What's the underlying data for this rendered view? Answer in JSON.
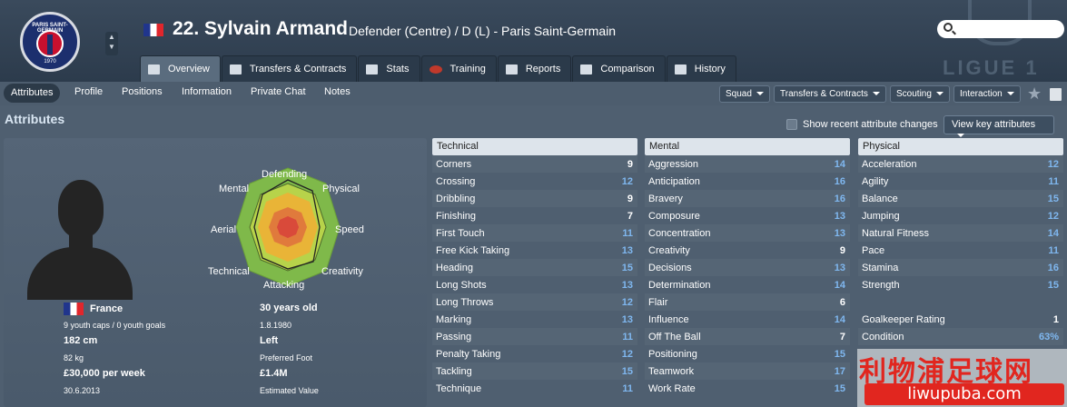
{
  "header": {
    "player_name": "22. Sylvain Armand",
    "role": "Defender (Centre) / D (L) - Paris Saint-Germain",
    "club_logo_text": "PARIS SAINT-GERMAIN",
    "club_logo_year": "1970",
    "league_logo_text": "LIGUE 1"
  },
  "tabs": [
    {
      "label": "Overview",
      "icon": "overview-icon",
      "active": true
    },
    {
      "label": "Transfers & Contracts",
      "icon": "contracts-icon"
    },
    {
      "label": "Stats",
      "icon": "stats-icon"
    },
    {
      "label": "Training",
      "icon": "training-icon"
    },
    {
      "label": "Reports",
      "icon": "reports-icon"
    },
    {
      "label": "Comparison",
      "icon": "comparison-icon"
    },
    {
      "label": "History",
      "icon": "history-icon"
    }
  ],
  "subnav": [
    "Attributes",
    "Profile",
    "Positions",
    "Information",
    "Private Chat",
    "Notes"
  ],
  "dropdowns": [
    "Squad",
    "Transfers & Contracts",
    "Scouting",
    "Interaction"
  ],
  "section_title": "Attributes",
  "show_recent_label": "Show recent attribute changes",
  "view_key_label": "View key attributes",
  "spider_labels": [
    "Defending",
    "Physical",
    "Speed",
    "Creativity",
    "Attacking",
    "Technical",
    "Aerial",
    "Mental"
  ],
  "profile": {
    "nation": "France",
    "caps": "9 youth caps / 0 youth goals",
    "age": "30 years old",
    "dob": "1.8.1980",
    "height": "182 cm",
    "weight": "82 kg",
    "foot": "Left",
    "foot_label": "Preferred Foot",
    "wage": "£30,000 per week",
    "contract_end": "30.6.2013",
    "value": "£1.4M",
    "value_label": "Estimated Value"
  },
  "technical": {
    "title": "Technical",
    "rows": [
      {
        "name": "Corners",
        "value": "9"
      },
      {
        "name": "Crossing",
        "value": "12"
      },
      {
        "name": "Dribbling",
        "value": "9"
      },
      {
        "name": "Finishing",
        "value": "7"
      },
      {
        "name": "First Touch",
        "value": "11"
      },
      {
        "name": "Free Kick Taking",
        "value": "13"
      },
      {
        "name": "Heading",
        "value": "15"
      },
      {
        "name": "Long Shots",
        "value": "13"
      },
      {
        "name": "Long Throws",
        "value": "12"
      },
      {
        "name": "Marking",
        "value": "13"
      },
      {
        "name": "Passing",
        "value": "11"
      },
      {
        "name": "Penalty Taking",
        "value": "12"
      },
      {
        "name": "Tackling",
        "value": "15"
      },
      {
        "name": "Technique",
        "value": "11"
      }
    ]
  },
  "mental": {
    "title": "Mental",
    "rows": [
      {
        "name": "Aggression",
        "value": "14"
      },
      {
        "name": "Anticipation",
        "value": "16"
      },
      {
        "name": "Bravery",
        "value": "16"
      },
      {
        "name": "Composure",
        "value": "13"
      },
      {
        "name": "Concentration",
        "value": "13"
      },
      {
        "name": "Creativity",
        "value": "9"
      },
      {
        "name": "Decisions",
        "value": "13"
      },
      {
        "name": "Determination",
        "value": "14"
      },
      {
        "name": "Flair",
        "value": "6"
      },
      {
        "name": "Influence",
        "value": "14"
      },
      {
        "name": "Off The Ball",
        "value": "7"
      },
      {
        "name": "Positioning",
        "value": "15"
      },
      {
        "name": "Teamwork",
        "value": "17"
      },
      {
        "name": "Work Rate",
        "value": "15"
      }
    ]
  },
  "physical": {
    "title": "Physical",
    "rows": [
      {
        "name": "Acceleration",
        "value": "12"
      },
      {
        "name": "Agility",
        "value": "11"
      },
      {
        "name": "Balance",
        "value": "15"
      },
      {
        "name": "Jumping",
        "value": "12"
      },
      {
        "name": "Natural Fitness",
        "value": "14"
      },
      {
        "name": "Pace",
        "value": "11"
      },
      {
        "name": "Stamina",
        "value": "16"
      },
      {
        "name": "Strength",
        "value": "15"
      }
    ],
    "extra": [
      {
        "name": "Goalkeeper Rating",
        "value": "1"
      },
      {
        "name": "Condition",
        "value": "63%"
      }
    ]
  },
  "watermark": {
    "cn": "利物浦足球网",
    "url": "liwupuba.com"
  }
}
